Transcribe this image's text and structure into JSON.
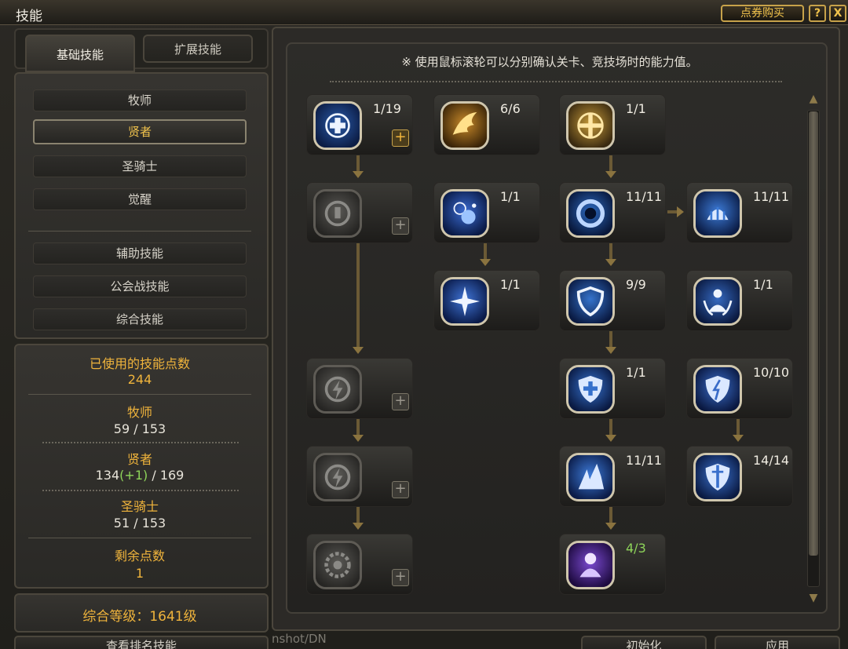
{
  "window": {
    "title": "技能",
    "buy_label": "点券购买",
    "help_label": "?",
    "close_label": "X"
  },
  "tabs": [
    {
      "label": "基础技能",
      "active": true
    },
    {
      "label": "扩展技能",
      "active": false
    }
  ],
  "categories": [
    {
      "label": "牧师",
      "active": false
    },
    {
      "label": "贤者",
      "active": true
    },
    {
      "label": "圣骑士",
      "active": false
    },
    {
      "label": "觉醒",
      "active": false
    },
    {
      "label": "辅助技能",
      "active": false
    },
    {
      "label": "公会战技能",
      "active": false
    },
    {
      "label": "综合技能",
      "active": false
    }
  ],
  "stats": {
    "used_label": "已使用的技能点数",
    "used_value": "244",
    "priest_label": "牧师",
    "priest_value": "59 / 153",
    "sage_label": "贤者",
    "sage_value_main": "134",
    "sage_value_bonus": "(+1)",
    "sage_value_total": " / 169",
    "paladin_label": "圣骑士",
    "paladin_value": "51 / 153",
    "remaining_label": "剩余点数",
    "remaining_value": "1",
    "level_text": "综合等级：1641级"
  },
  "hint": "※ 使用鼠标滚轮可以分别确认关卡、竞技场时的能力值。",
  "skills": [
    {
      "id": "holy-cross",
      "level": "1/19",
      "locked": false,
      "plus": "active",
      "icon": "cross-icon"
    },
    {
      "id": "wing",
      "level": "6/6",
      "locked": false,
      "plus": "none",
      "icon": "wing-icon"
    },
    {
      "id": "golden-cross",
      "level": "1/1",
      "locked": false,
      "plus": "none",
      "icon": "golden-cross-icon"
    },
    {
      "id": "locked-1",
      "level": "",
      "locked": true,
      "plus": "disabled",
      "icon": "locked-skill-icon"
    },
    {
      "id": "frost-orb",
      "level": "1/1",
      "locked": false,
      "plus": "none",
      "icon": "frost-orb-icon"
    },
    {
      "id": "ring",
      "level": "11/11",
      "locked": false,
      "plus": "none",
      "icon": "ring-icon"
    },
    {
      "id": "shield-wall",
      "level": "11/11",
      "locked": false,
      "plus": "none",
      "icon": "shield-wall-icon"
    },
    {
      "id": "star-burst",
      "level": "1/1",
      "locked": false,
      "plus": "none",
      "icon": "star-burst-icon"
    },
    {
      "id": "shield",
      "level": "9/9",
      "locked": false,
      "plus": "none",
      "icon": "shield-icon"
    },
    {
      "id": "guardian",
      "level": "1/1",
      "locked": false,
      "plus": "none",
      "icon": "guardian-icon"
    },
    {
      "id": "locked-2",
      "level": "",
      "locked": true,
      "plus": "disabled",
      "icon": "locked-bolt-icon"
    },
    {
      "id": "holy-shield",
      "level": "1/1",
      "locked": false,
      "plus": "none",
      "icon": "holy-shield-icon"
    },
    {
      "id": "broken-shield",
      "level": "10/10",
      "locked": false,
      "plus": "none",
      "icon": "lightning-shield-icon"
    },
    {
      "id": "locked-3",
      "level": "",
      "locked": true,
      "plus": "disabled",
      "icon": "locked-bolt-icon"
    },
    {
      "id": "ice-burst",
      "level": "11/11",
      "locked": false,
      "plus": "none",
      "icon": "ice-burst-icon"
    },
    {
      "id": "sword-shield",
      "level": "14/14",
      "locked": false,
      "plus": "none",
      "icon": "sword-shield-icon"
    },
    {
      "id": "locked-4",
      "level": "",
      "locked": true,
      "plus": "disabled",
      "icon": "locked-gear-icon"
    },
    {
      "id": "spirit",
      "level": "4/3",
      "locked": false,
      "plus": "none",
      "icon": "spirit-icon",
      "level_color": "#8ed45a"
    }
  ],
  "bottom": {
    "ranking_label": "查看排名技能",
    "reset_label": "初始化",
    "apply_label": "应用",
    "path_fragment": "nshot/DN"
  },
  "colors": {
    "gold": "#f0b43c",
    "green": "#8ed45a",
    "frame": "#cfc6ad"
  }
}
